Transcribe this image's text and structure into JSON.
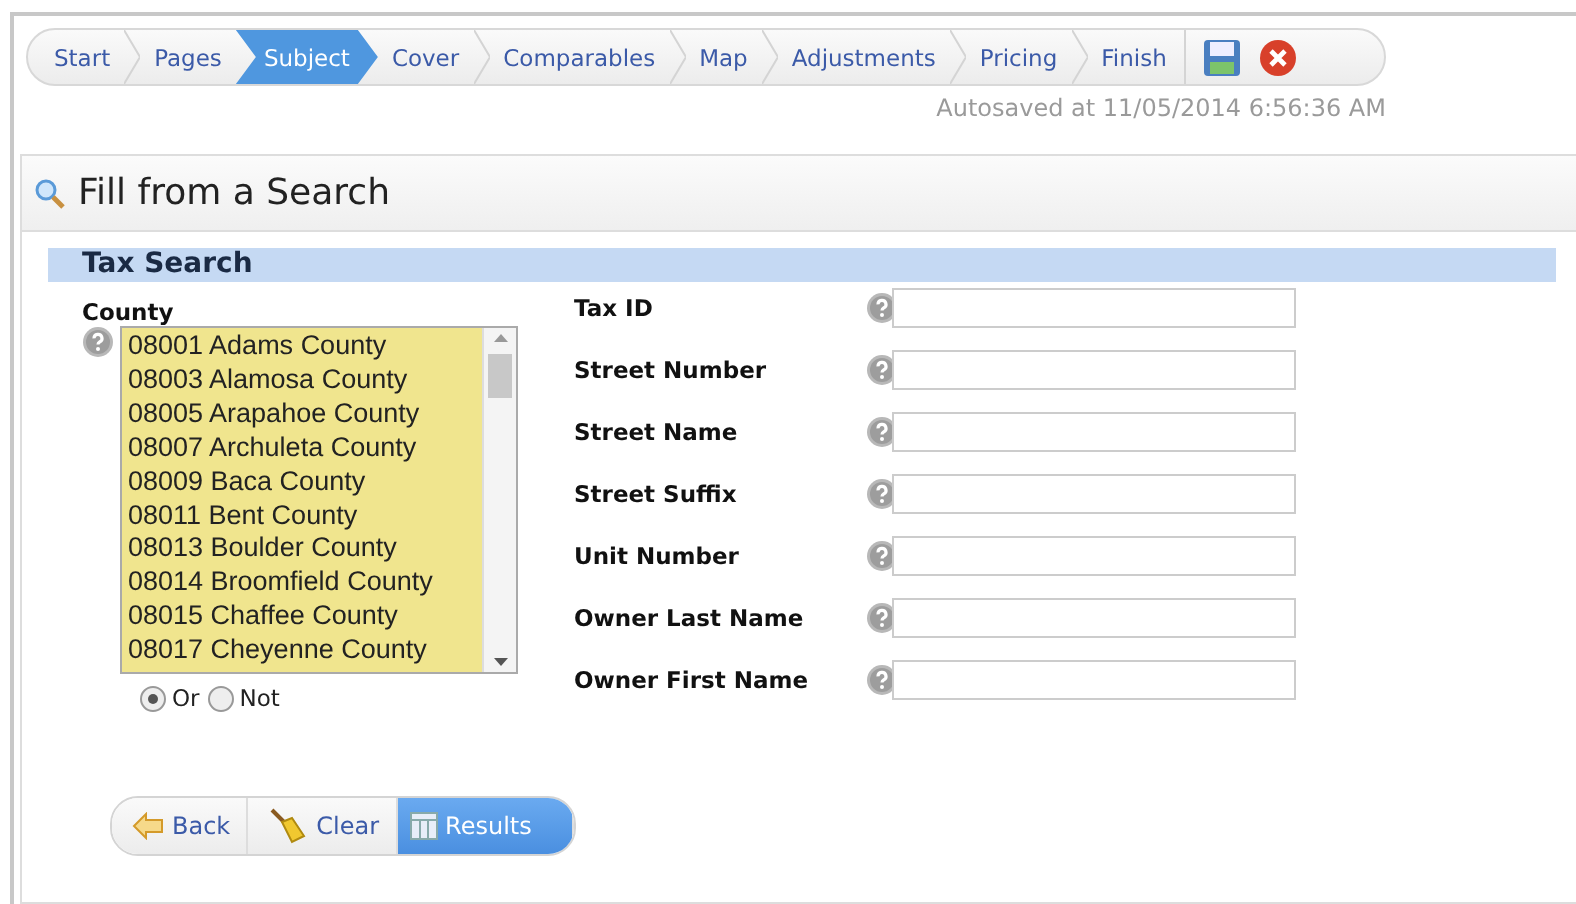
{
  "wizard": {
    "steps": [
      {
        "label": "Start",
        "selected": false
      },
      {
        "label": "Pages",
        "selected": false
      },
      {
        "label": "Subject",
        "selected": true
      },
      {
        "label": "Cover",
        "selected": false
      },
      {
        "label": "Comparables",
        "selected": false
      },
      {
        "label": "Map",
        "selected": false
      },
      {
        "label": "Adjustments",
        "selected": false
      },
      {
        "label": "Pricing",
        "selected": false
      },
      {
        "label": "Finish",
        "selected": false
      }
    ],
    "autosave": "Autosaved at 11/05/2014 6:56:36 AM"
  },
  "panel": {
    "title": "Fill from a Search",
    "section": "Tax Search",
    "county": {
      "label": "County",
      "options": [
        "08001 Adams County",
        "08003 Alamosa County",
        "08005 Arapahoe County",
        "08007 Archuleta County",
        "08009 Baca County",
        "08011 Bent County",
        "08013 Boulder County",
        "08014 Broomfield County",
        "08015 Chaffee County",
        "08017 Cheyenne County"
      ],
      "modes": [
        {
          "label": "Or",
          "selected": true
        },
        {
          "label": "Not",
          "selected": false
        }
      ]
    },
    "fields": [
      {
        "label": "Tax ID"
      },
      {
        "label": "Street Number"
      },
      {
        "label": "Street Name"
      },
      {
        "label": "Street Suffix"
      },
      {
        "label": "Unit Number"
      },
      {
        "label": "Owner Last Name"
      },
      {
        "label": "Owner First Name"
      }
    ],
    "buttons": [
      {
        "label": "Back",
        "kind": "back",
        "highlighted": false
      },
      {
        "label": "Clear",
        "kind": "clear",
        "highlighted": false
      },
      {
        "label": "Results",
        "kind": "results",
        "highlighted": true
      }
    ]
  }
}
